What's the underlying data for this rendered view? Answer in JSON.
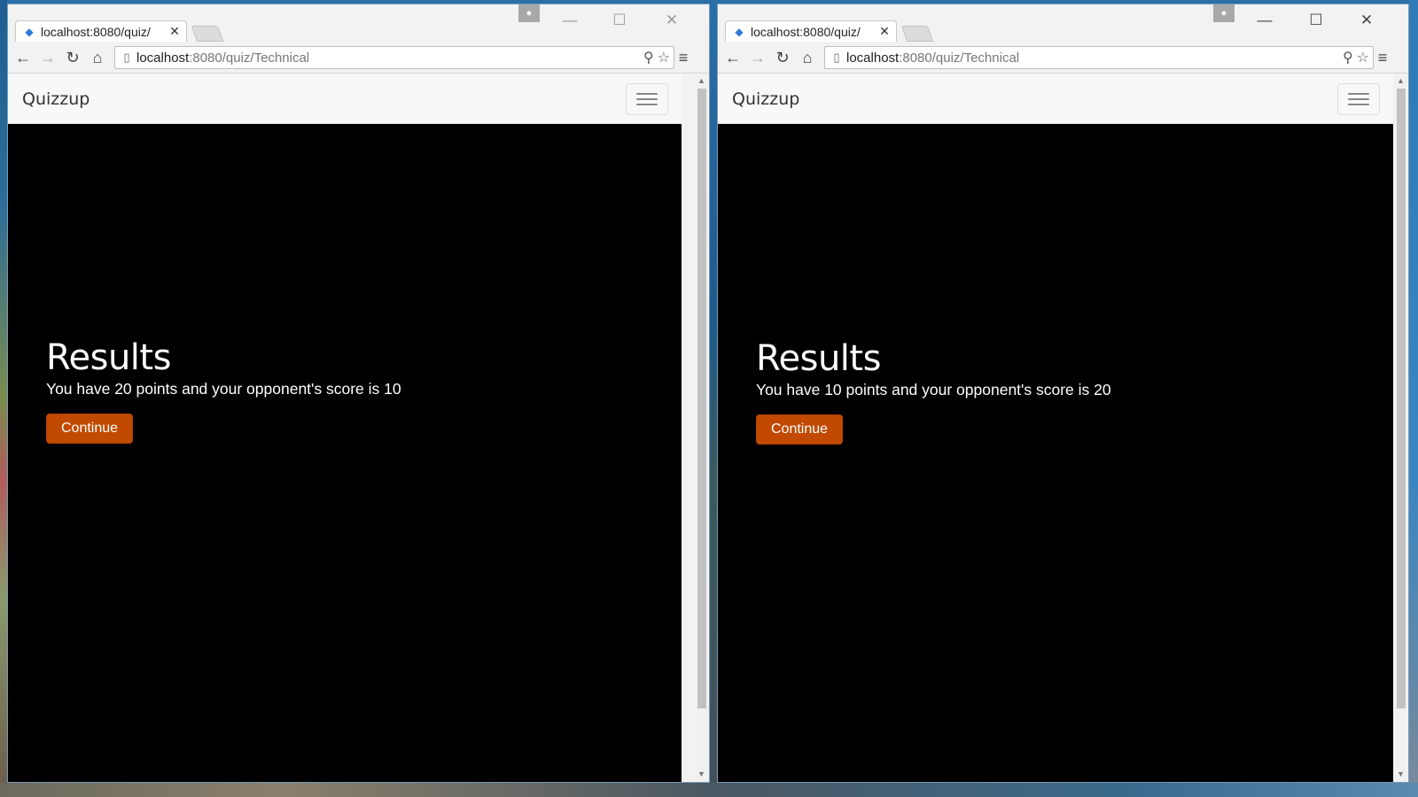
{
  "windows": [
    {
      "tab": {
        "title": "localhost:8080/quiz/",
        "close": "✕"
      },
      "url": {
        "host": "localhost",
        "path": ":8080/quiz/Technical"
      },
      "brand": "Quizzup",
      "results": {
        "title": "Results",
        "score_text": "You have 20 points and your opponent's score is 10",
        "continue_label": "Continue"
      }
    },
    {
      "tab": {
        "title": "localhost:8080/quiz/",
        "close": "✕"
      },
      "url": {
        "host": "localhost",
        "path": ":8080/quiz/Technical"
      },
      "brand": "Quizzup",
      "results": {
        "title": "Results",
        "score_text": "You have 10 points and your opponent's score is 20",
        "continue_label": "Continue"
      }
    }
  ],
  "icons": {
    "back": "←",
    "forward": "→",
    "reload": "↻",
    "home": "⌂",
    "zoom": "⚲",
    "star": "☆",
    "menu": "≡",
    "minimize": "—",
    "maximize": "☐",
    "close": "✕",
    "page": "▯",
    "favicon": "◆",
    "profile": "●",
    "scroll_up": "▲",
    "scroll_down": "▼"
  },
  "colors": {
    "accent_button": "#c14a00",
    "page_background": "#000000",
    "navbar_background": "#f8f8f8"
  }
}
